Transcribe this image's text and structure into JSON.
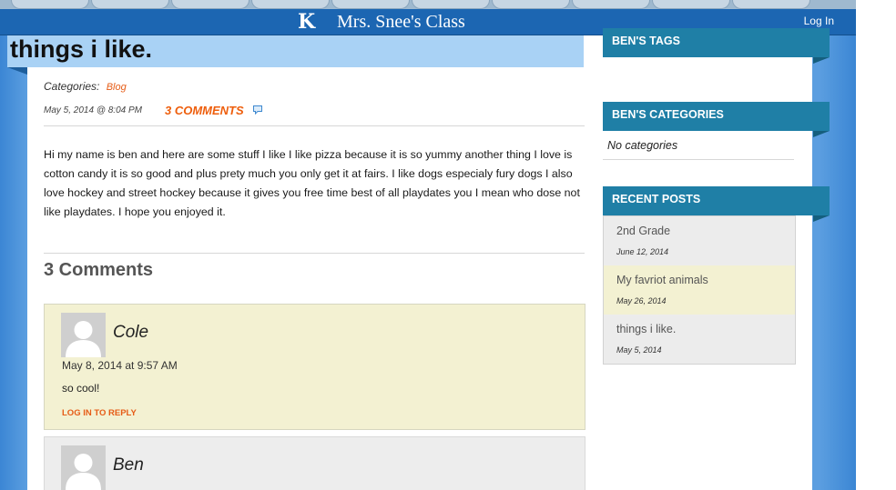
{
  "header": {
    "logo_letter": "K",
    "site_title": "Mrs. Snee's Class",
    "login_label": "Log In"
  },
  "post": {
    "title": "things i like.",
    "categories_label": "Categories:",
    "category": "Blog",
    "date": "May 5, 2014 @ 8:04 PM",
    "comments_link": "3 COMMENTS",
    "body": "Hi my name is ben and here are some stuff I like I like pizza because it is so yummy  another thing I love is cotton candy it is so good and plus prety much you only get it at fairs. I like dogs especialy fury dogs I also love hockey and street hockey because it gives you free time best of all playdates you I mean who dose not like playdates. I hope you enjoyed it."
  },
  "comments": {
    "heading": "3 Comments",
    "items": [
      {
        "author": "Cole",
        "date": "May 8, 2014 at 9:57 AM",
        "text": "so cool!",
        "reply_label": "LOG IN TO REPLY"
      },
      {
        "author": "Ben"
      }
    ]
  },
  "sidebar": {
    "tags_heading": "BEN'S TAGS",
    "categories_heading": "BEN'S CATEGORIES",
    "no_categories": "No categories",
    "recent_heading": "RECENT POSTS",
    "recent_posts": [
      {
        "title": "2nd Grade",
        "date": "June 12, 2014"
      },
      {
        "title": "My favriot animals",
        "date": "May 26, 2014"
      },
      {
        "title": "things i like.",
        "date": "May 5, 2014"
      }
    ]
  },
  "icons": {
    "comment_bubble": "speech-bubble-icon",
    "avatar": "default-avatar-icon"
  },
  "colors": {
    "header_blue": "#1c66b2",
    "accent_orange": "#e65c16",
    "widget_teal": "#1f7fa6",
    "title_banner": "#a9d2f5",
    "comment_highlight": "#f3f1d2"
  }
}
